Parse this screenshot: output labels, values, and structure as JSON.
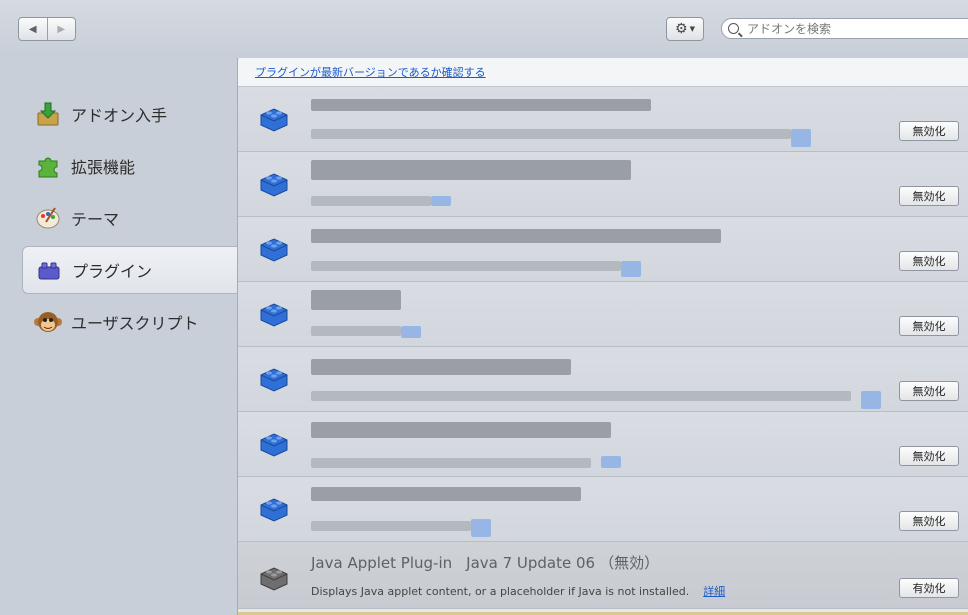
{
  "toolbar": {
    "back_icon": "back-arrow-icon",
    "forward_icon": "forward-arrow-icon",
    "gear_icon": "gear-icon",
    "search_placeholder": "アドオンを検索"
  },
  "sidebar": {
    "items": [
      {
        "label": "アドオン入手",
        "icon": "get-addons-icon",
        "selected": false
      },
      {
        "label": "拡張機能",
        "icon": "puzzle-piece-icon",
        "selected": false
      },
      {
        "label": "テーマ",
        "icon": "palette-icon",
        "selected": false
      },
      {
        "label": "プラグイン",
        "icon": "plugin-brick-icon",
        "selected": true
      },
      {
        "label": "ユーザスクリプト",
        "icon": "monkey-icon",
        "selected": false
      }
    ]
  },
  "main": {
    "check_link": "プラグインが最新バージョンであるか確認する",
    "plugins": [
      {
        "button": "無効化",
        "icon": "blue-lego-brick-icon"
      },
      {
        "button": "無効化",
        "icon": "blue-lego-brick-icon"
      },
      {
        "button": "無効化",
        "icon": "blue-lego-brick-icon"
      },
      {
        "button": "無効化",
        "icon": "blue-lego-brick-icon"
      },
      {
        "button": "無効化",
        "icon": "blue-lego-brick-icon"
      },
      {
        "button": "無効化",
        "icon": "blue-lego-brick-icon"
      },
      {
        "button": "無効化",
        "icon": "blue-lego-brick-icon"
      }
    ],
    "java": {
      "name": "Java Applet Plug-in",
      "version": "Java 7 Update 06",
      "status": "（無効）",
      "description": "Displays Java applet content, or a placeholder if Java is not installed.",
      "details_link": "詳細",
      "button": "有効化",
      "icon": "gray-lego-brick-icon"
    }
  },
  "colors": {
    "link": "#1b5cc8",
    "brick_blue": "#2f6fd6",
    "brick_gray": "#6e6e6e"
  }
}
